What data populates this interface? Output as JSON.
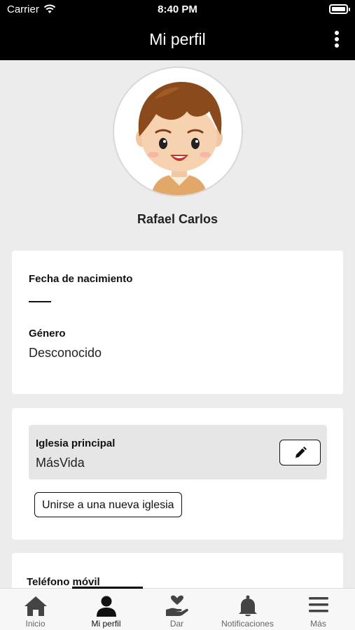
{
  "status_bar": {
    "carrier": "Carrier",
    "time": "8:40 PM"
  },
  "header": {
    "title": "Mi perfil",
    "menu_icon": "more-vertical-icon"
  },
  "profile": {
    "name": "Rafael Carlos",
    "avatar_icon": "boy-avatar"
  },
  "info": {
    "birth_label": "Fecha de nacimiento",
    "gender_label": "Género",
    "gender_value": "Desconocido"
  },
  "church": {
    "label": "Iglesia principal",
    "value": "MásVida",
    "edit_icon": "pencil-icon",
    "join_label": "Unirse a una nueva iglesia"
  },
  "contact": {
    "phone_label": "Teléfono móvil"
  },
  "tabs": [
    {
      "label": "Inicio",
      "icon": "home-icon",
      "active": false
    },
    {
      "label": "Mi perfil",
      "icon": "person-icon",
      "active": true
    },
    {
      "label": "Dar",
      "icon": "give-heart-icon",
      "active": false
    },
    {
      "label": "Notificaciones",
      "icon": "bell-icon",
      "active": false
    },
    {
      "label": "Más",
      "icon": "menu-icon",
      "active": false
    }
  ],
  "colors": {
    "header_bg": "#000000",
    "page_bg": "#ececec",
    "card_bg": "#ffffff",
    "church_box_bg": "#e6e6e6",
    "tab_icon": "#444444"
  }
}
